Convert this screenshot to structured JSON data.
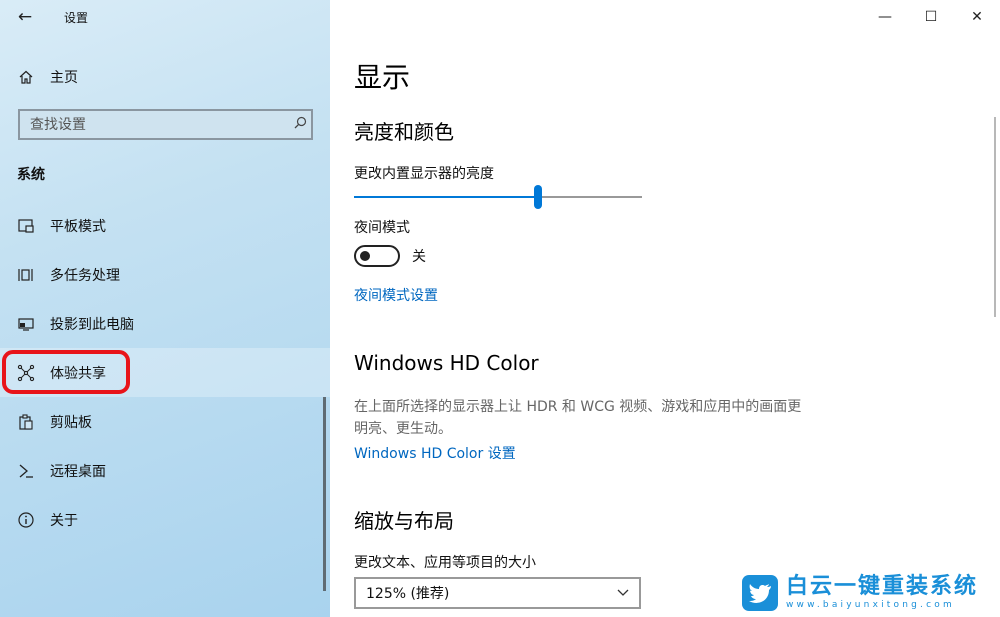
{
  "window": {
    "title": "设置",
    "back_icon": "back-arrow-icon",
    "controls": {
      "minimize": "minimize-icon",
      "maximize": "maximize-icon",
      "close": "close-icon"
    }
  },
  "sidebar": {
    "home_label": "主页",
    "search_placeholder": "查找设置",
    "section_header": "系统",
    "items": [
      {
        "label": "平板模式",
        "icon": "tablet-mode-icon"
      },
      {
        "label": "多任务处理",
        "icon": "multitasking-icon"
      },
      {
        "label": "投影到此电脑",
        "icon": "projecting-icon"
      },
      {
        "label": "体验共享",
        "icon": "shared-experiences-icon"
      },
      {
        "label": "剪贴板",
        "icon": "clipboard-icon"
      },
      {
        "label": "远程桌面",
        "icon": "remote-desktop-icon"
      },
      {
        "label": "关于",
        "icon": "info-icon"
      }
    ],
    "selected_index": 3
  },
  "main": {
    "page_title": "显示",
    "brightness_section": {
      "heading": "亮度和颜色",
      "brightness_label": "更改内置显示器的亮度",
      "brightness_fraction": 0.64,
      "night_mode_label": "夜间模式",
      "night_mode_state": "关",
      "night_mode_on": false,
      "night_mode_link": "夜间模式设置"
    },
    "hd_color": {
      "heading": "Windows HD Color",
      "desc_line1": "在上面所选择的显示器上让 HDR 和 WCG 视频、游戏和应用中的画面更",
      "desc_line2": "明亮、更生动。",
      "link": "Windows HD Color 设置"
    },
    "scale_layout": {
      "heading": "缩放与布局",
      "text_size_label": "更改文本、应用等项目的大小",
      "scale_value": "125% (推荐)"
    }
  },
  "watermark": {
    "cn": "白云一键重装系统",
    "en": "www.baiyunxitong.com"
  },
  "colors": {
    "accent": "#0078d7",
    "link": "#0067c0",
    "highlight": "#e8141a"
  }
}
